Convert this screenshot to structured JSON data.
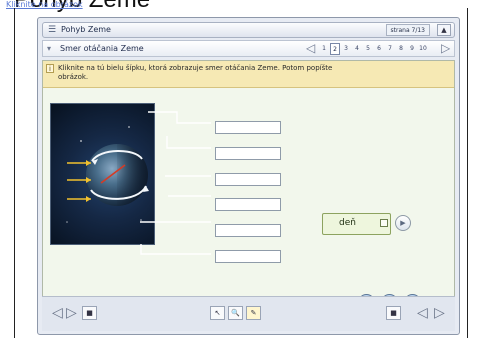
{
  "window": {
    "title": "Pohyb Zeme",
    "page_indicator": "strana 7/13"
  },
  "section": {
    "title": "Smer otáčania Zeme",
    "pages": [
      "1",
      "2",
      "3",
      "4",
      "5",
      "6",
      "7",
      "8",
      "9",
      "10"
    ],
    "current_page": "2"
  },
  "instruction": {
    "text": "Kliknite na tú bielu šípku, ktorá zobrazuje smer otáčania Zeme. Potom popíšte obrázok."
  },
  "diagram": {
    "answer_fields": [
      "",
      "",
      "",
      "",
      "",
      ""
    ],
    "day_label": "deň"
  },
  "colors": {
    "instruction_bg": "#f6e9b4",
    "content_bg": "#f2f7ec",
    "accent_red": "#d63a24",
    "arrow_yellow": "#f2c12e"
  }
}
